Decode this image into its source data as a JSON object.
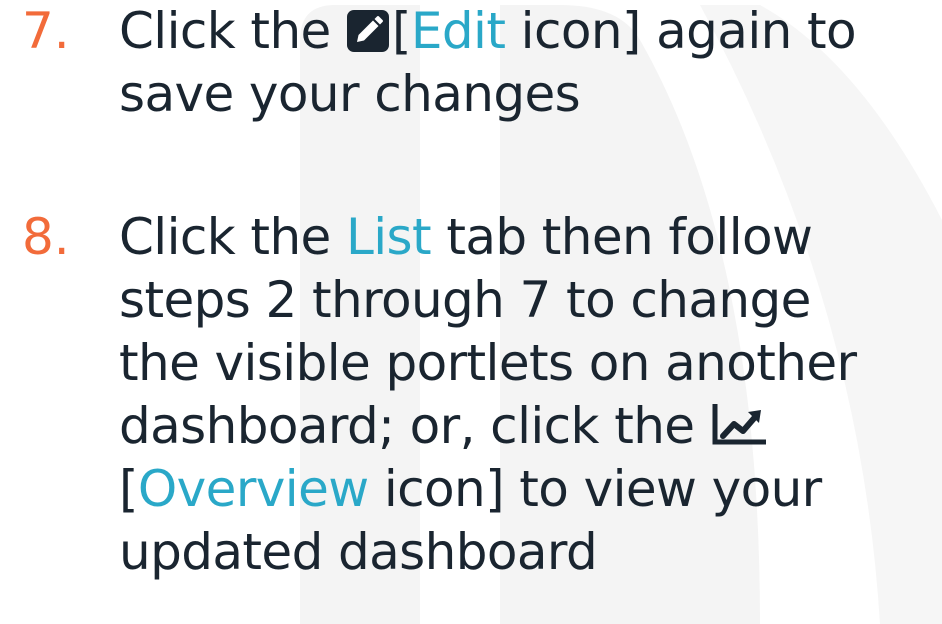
{
  "colors": {
    "step_number": "#f26b3a",
    "link": "#2aa8c8",
    "text": "#1a2530",
    "watermark": "#f3f3f3"
  },
  "icons": {
    "edit": "pencil-square-icon",
    "overview": "line-chart-icon"
  },
  "steps": [
    {
      "number": "7.",
      "parts": {
        "a": "Click the",
        "b": "[",
        "c": "Edit",
        "d": "icon] again to",
        "e": "save your changes"
      }
    },
    {
      "number": "8.",
      "parts": {
        "a": "Click the",
        "b": "List",
        "c": "tab then follow",
        "d": "steps 2 through 7 to change",
        "e": "the visible portlets on another",
        "f": "dashboard; or, click the",
        "g": "[",
        "h": "Overview",
        "i": "icon] to view your",
        "j": "updated dashboard"
      }
    }
  ]
}
